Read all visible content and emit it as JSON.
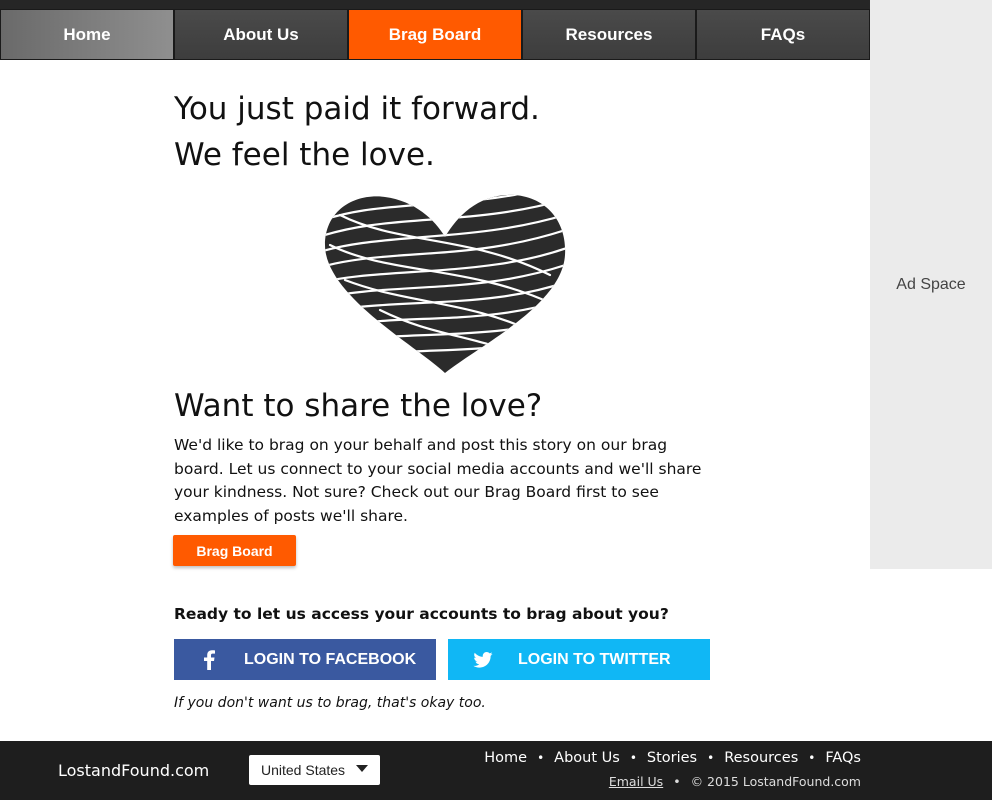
{
  "nav": {
    "items": [
      {
        "label": "Home"
      },
      {
        "label": "About Us"
      },
      {
        "label": "Brag Board",
        "active": true
      },
      {
        "label": "Resources"
      },
      {
        "label": "FAQs"
      }
    ]
  },
  "ad": {
    "label": "Ad Space"
  },
  "main": {
    "headline_line1": "You just paid it forward.",
    "headline_line2": "We feel the love.",
    "heart_icon": "scribble-heart-icon",
    "share_title": "Want to share the love?",
    "share_text": "We'd like to brag on your behalf and post this story on our brag board. Let us connect to your social media accounts and we'll share your kindness. Not sure? Check out our Brag Board first to see examples of posts we'll share.",
    "brag_button": "Brag Board",
    "ready_text": "Ready to let us access your accounts to brag about you?",
    "facebook_button": "LOGIN TO FACEBOOK",
    "twitter_button": "LOGIN TO TWITTER",
    "decline_text": "If you don't want us to brag, that's okay too."
  },
  "footer": {
    "brand": "LostandFound.com",
    "country_select": "United States",
    "links": [
      "Home",
      "About Us",
      "Stories",
      "Resources",
      "FAQs"
    ],
    "email_link": "Email Us",
    "copyright": "© 2015 LostandFound.com"
  },
  "colors": {
    "accent": "#ff5a00",
    "facebook": "#3a59a0",
    "twitter": "#10b7f5",
    "nav_bg": "#3d3d3d",
    "footer_bg": "#1e1e1e",
    "ad_bg": "#ebebeb"
  }
}
